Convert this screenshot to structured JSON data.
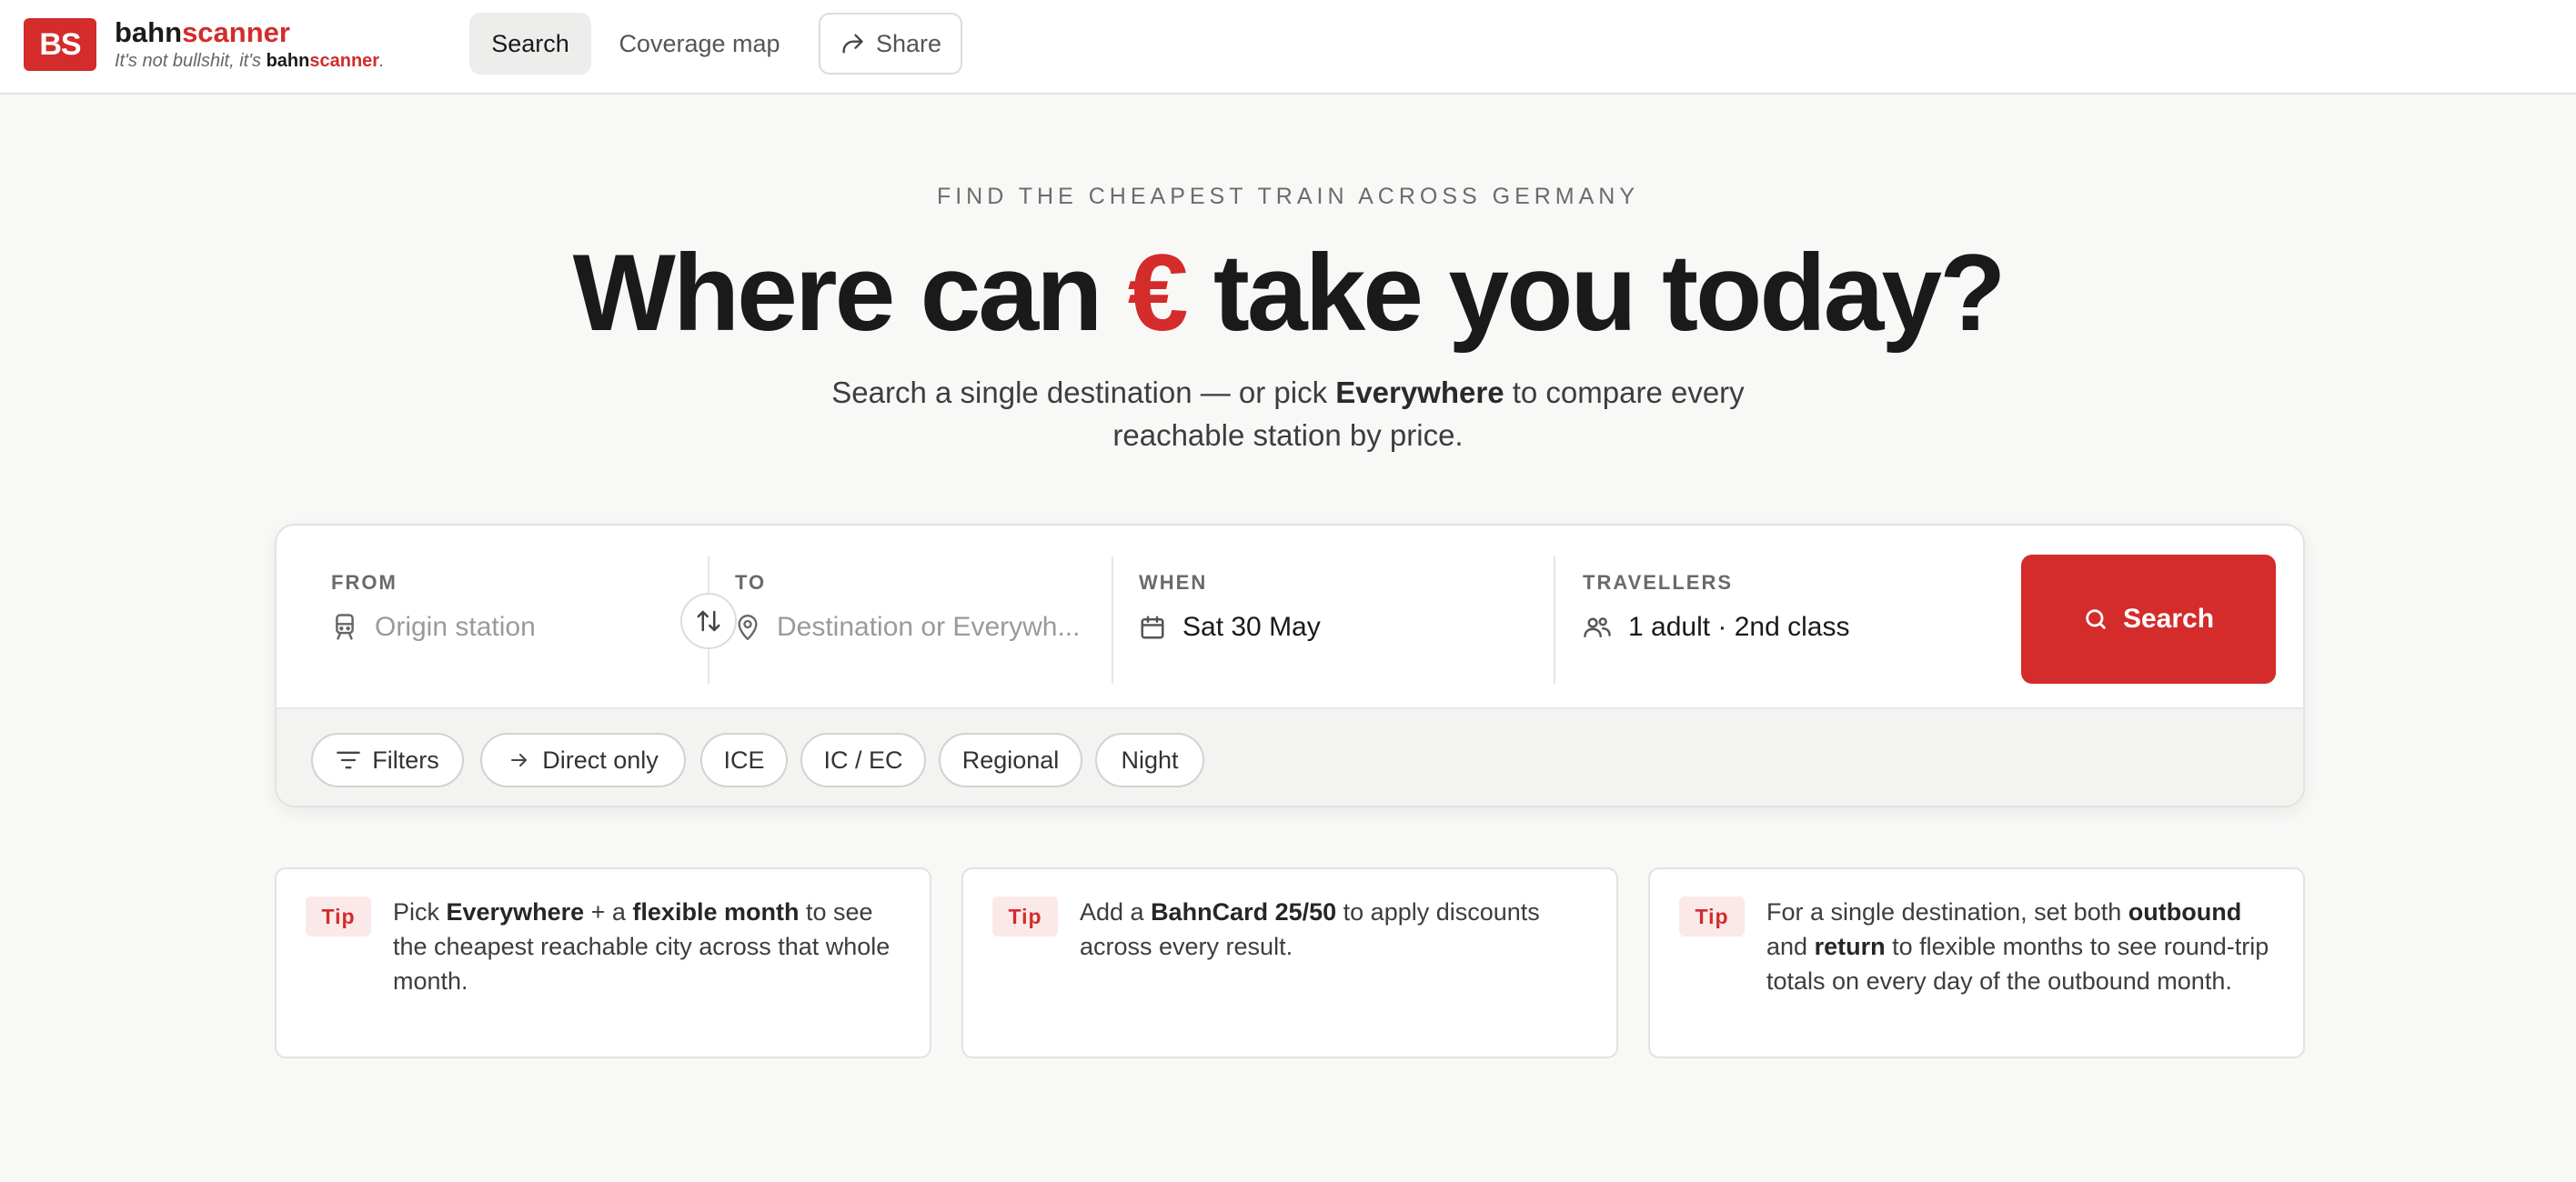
{
  "header": {
    "logo_text": "BS",
    "brand_part1": "bahn",
    "brand_part2": "scanner",
    "tagline_prefix": "It's not bullshit, it's ",
    "tagline_bahn": "bahn",
    "tagline_scanner": "scanner",
    "tagline_suffix": ".",
    "nav": {
      "search": "Search",
      "coverage": "Coverage map",
      "share": "Share"
    }
  },
  "hero": {
    "eyebrow": "FIND THE CHEAPEST TRAIN ACROSS GERMANY",
    "headline_before": "Where can ",
    "headline_symbol": "€",
    "headline_after": " take you today?",
    "subtitle_before": "Search a single destination — or pick ",
    "subtitle_bold": "Everywhere",
    "subtitle_after": " to compare every reachable station by price."
  },
  "search_form": {
    "from": {
      "label": "FROM",
      "placeholder": "Origin station"
    },
    "to": {
      "label": "TO",
      "placeholder": "Destination or Everywh..."
    },
    "when": {
      "label": "WHEN",
      "value": "Sat 30 May"
    },
    "travellers": {
      "label": "TRAVELLERS",
      "value": "1 adult · 2nd class"
    },
    "submit": "Search"
  },
  "filters": {
    "filters_label": "Filters",
    "direct_only": "Direct only",
    "chips": [
      "ICE",
      "IC / EC",
      "Regional",
      "Night"
    ]
  },
  "tips": [
    {
      "badge": "Tip",
      "p1": "Pick ",
      "b1": "Everywhere",
      "p2": " + a ",
      "b2": "flexible month",
      "p3": " to see the cheapest reachable city across that whole month."
    },
    {
      "badge": "Tip",
      "p1": "Add a ",
      "b1": "BahnCard 25/50",
      "p2": " to apply discounts across every result."
    },
    {
      "badge": "Tip",
      "p1": "For a single destination, set both ",
      "b1": "outbound",
      "p2": " and ",
      "b2": "return",
      "p3": " to flexible months to see round-trip totals on every day of the outbound month."
    }
  ],
  "colors": {
    "accent": "#d42b2b",
    "background": "#f8f8f7",
    "text": "#1a1a1a"
  },
  "icons": [
    "train-icon",
    "swap-icon",
    "location-pin-icon",
    "calendar-icon",
    "users-icon",
    "search-icon",
    "filter-icon",
    "arrow-right-icon",
    "share-icon"
  ]
}
